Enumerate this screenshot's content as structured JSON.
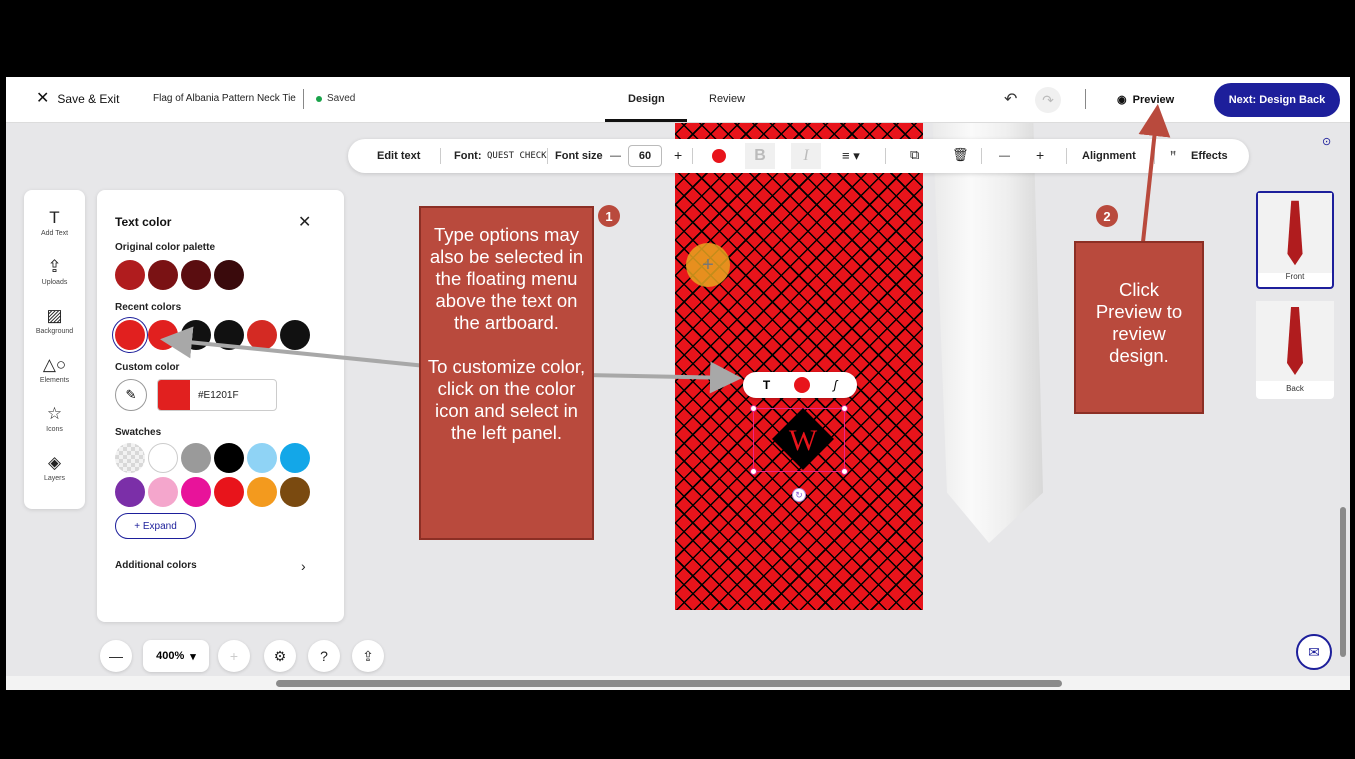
{
  "topbar": {
    "save_exit": "Save & Exit",
    "doc_title": "Flag of Albania Pattern Neck Tie",
    "saved": "Saved",
    "tabs": [
      {
        "label": "Design"
      },
      {
        "label": "Review"
      }
    ],
    "preview": "Preview",
    "next": "Next: Design Back"
  },
  "toolbar": {
    "edit_text": "Edit text",
    "font_label": "Font:",
    "font_name": "QUEST CHECK",
    "font_size_label": "Font size",
    "font_size_value": "60",
    "minus": "—",
    "plus": "+",
    "bold": "B",
    "italic": "I",
    "alignment": "Alignment",
    "effects": "Effects",
    "color": "#e8141b"
  },
  "rail": {
    "items": [
      {
        "label": "Add Text",
        "icon": "T"
      },
      {
        "label": "Uploads",
        "icon": "⇪"
      },
      {
        "label": "Background",
        "icon": "▨"
      },
      {
        "label": "Elements",
        "icon": "△○"
      },
      {
        "label": "Icons",
        "icon": "☆"
      },
      {
        "label": "Layers",
        "icon": "◈"
      }
    ]
  },
  "panel": {
    "title": "Text color",
    "original_palette_label": "Original color palette",
    "original_palette": [
      "#b01c1e",
      "#7a1214",
      "#5a0d10",
      "#3a0a0c"
    ],
    "recent_label": "Recent colors",
    "recent": [
      "#e1201f",
      "#e1201f",
      "#111111",
      "#111111",
      "#d42a23",
      "#111111"
    ],
    "custom_label": "Custom color",
    "custom_hex": "#E1201F",
    "swatches_label": "Swatches",
    "swatches": [
      "#d0d0d0",
      "#ffffff",
      "#9a9a9a",
      "#000000",
      "#8fd3f5",
      "#13a7e8",
      "#7b2fa8",
      "#f4a6cc",
      "#e8139a",
      "#e8141b",
      "#f39a1e",
      "#7a4a10"
    ],
    "expand": "+ Expand",
    "additional": "Additional colors"
  },
  "annotations": {
    "badge1": "1",
    "badge2": "2",
    "callout1": "Type options may also be selected in the floating menu above the text on the artboard.\n\nTo customize color, click on the color icon and select in the left panel.",
    "callout2": "Click Preview to review design."
  },
  "thumbs": [
    {
      "label": "Front"
    },
    {
      "label": "Back"
    }
  ],
  "zoom": {
    "value": "400%"
  },
  "canvas": {
    "logo_letter": "W",
    "pattern_color": "#e8141b"
  }
}
